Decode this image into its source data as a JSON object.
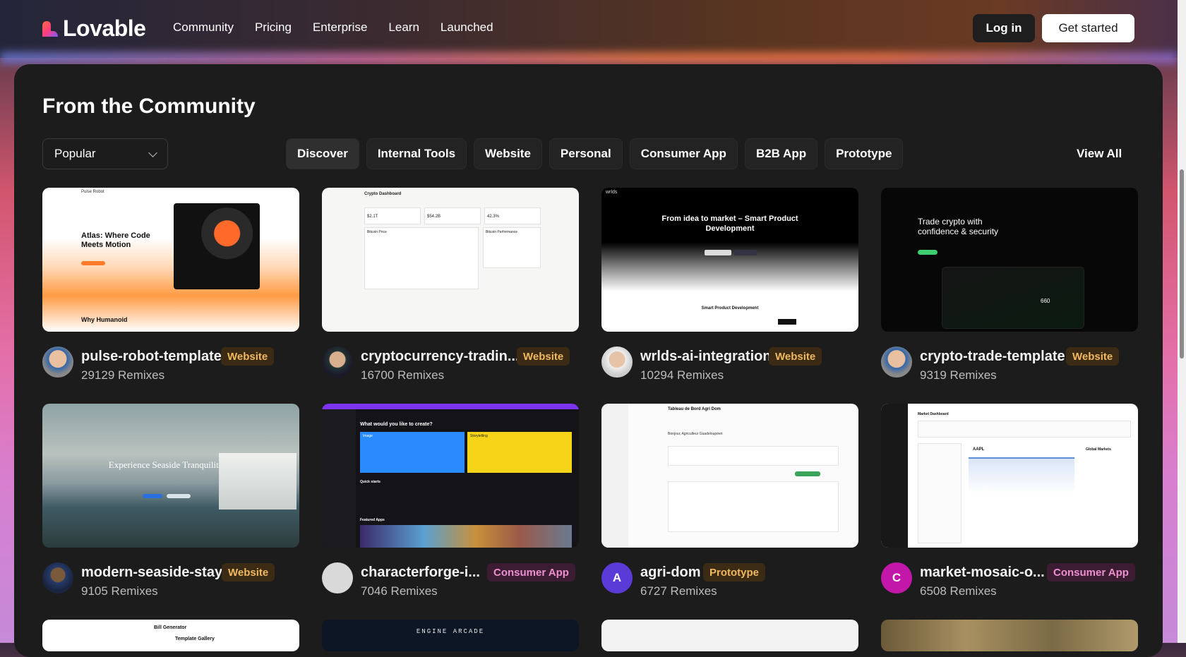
{
  "brand": {
    "name": "Lovable"
  },
  "nav": {
    "items": [
      "Community",
      "Pricing",
      "Enterprise",
      "Learn",
      "Launched"
    ]
  },
  "auth": {
    "login": "Log in",
    "get_started": "Get started"
  },
  "section": {
    "title": "From the Community",
    "sort_value": "Popular",
    "filters": [
      "Discover",
      "Internal Tools",
      "Website",
      "Personal",
      "Consumer App",
      "B2B App",
      "Prototype"
    ],
    "active_filter": "Discover",
    "view_all": "View All"
  },
  "projects": [
    {
      "name": "pulse-robot-template",
      "badge": "Website",
      "remixes": "29129 Remixes",
      "thumb_text": [
        "Pulse Robot",
        "Atlas: Where Code Meets Motion",
        "Why Humanoid"
      ]
    },
    {
      "name": "cryptocurrency-tradin...",
      "badge": "Website",
      "remixes": "16700 Remixes",
      "thumb_text": [
        "Crypto Dashboard",
        "Bitcoin Price",
        "Bitcoin Performance",
        "$2.1T",
        "$54.2B",
        "42.3%"
      ]
    },
    {
      "name": "wrlds-ai-integration",
      "badge": "Website",
      "remixes": "10294 Remixes",
      "thumb_text": [
        "wrlds",
        "From idea to market – Smart Product Development",
        "Smart Product Development"
      ]
    },
    {
      "name": "crypto-trade-template",
      "badge": "Website",
      "remixes": "9319 Remixes",
      "thumb_text": [
        "Trade crypto with confidence & security",
        "660"
      ]
    },
    {
      "name": "modern-seaside-stay",
      "badge": "Website",
      "remixes": "9105 Remixes",
      "thumb_text": [
        "Experience Seaside Tranquility"
      ]
    },
    {
      "name": "characterforge-i...",
      "badge": "Consumer App",
      "remixes": "7046 Remixes",
      "thumb_text": [
        "What would you like to create?",
        "Image",
        "Storytelling",
        "Quick starts",
        "Featured Apps"
      ]
    },
    {
      "name": "agri-dom",
      "badge": "Prototype",
      "remixes": "6727 Remixes",
      "avatar_letter": "A",
      "thumb_text": [
        "Tableau de Bord Agri Dom",
        "Bonjour, Agriculteur Guadeloupéen"
      ]
    },
    {
      "name": "market-mosaic-o...",
      "badge": "Consumer App",
      "remixes": "6508 Remixes",
      "avatar_letter": "C",
      "thumb_text": [
        "Market Dashboard",
        "AAPL",
        "Global Markets"
      ]
    }
  ],
  "partial_row": {
    "texts": [
      "Bill Generator",
      "Template Gallery",
      "ENGINE ARCADE"
    ]
  },
  "colors": {
    "panel": "#1c1c1c",
    "badge_website": "#f0b860",
    "badge_consumer": "#ec8fcf",
    "avatar_a": "#5b3bd8",
    "avatar_c": "#c217a8"
  },
  "icons": [
    "lovable-logo-icon",
    "chevron-down-icon"
  ]
}
